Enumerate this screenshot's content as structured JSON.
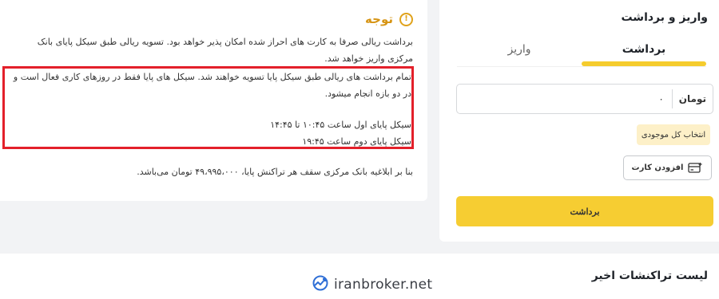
{
  "notice": {
    "title": "توجه",
    "para1": "برداشت ریالی صرفا به کارت های احراز شده امکان پذیر خواهد بود. تسویه ریالی طبق سیکل پایای بانک مرکزی واریز خواهد شد.",
    "para2": "تمام برداشت های ریالی طبق سیکل پایا تسویه خواهند شد. سیکل های پایا فقط در روزهای کاری فعال است و در دو بازه انجام میشود.",
    "cycle1": "سیکل پایای اول ساعت ۱۰:۴۵ تا ۱۴:۴۵",
    "cycle2": "سیکل پایای دوم ساعت ۱۹:۴۵",
    "para3": "بنا بر ابلاغیه بانک مرکزی سقف هر تراکنش پایا، ۴۹،۹۹۵،۰۰۰ تومان می‌باشد."
  },
  "card": {
    "title": "واریز و برداشت",
    "tabs": {
      "withdraw": "برداشت",
      "deposit": "واریز"
    },
    "amount": {
      "value": "۰",
      "unit": "تومان"
    },
    "select_all": "انتخاب کل موجودی",
    "add_card": "افزودن کارت",
    "submit": "برداشت"
  },
  "recent": {
    "title": "لیست تراکنشات اخیر"
  },
  "watermark": {
    "text": "iranbroker.net"
  },
  "colors": {
    "accent": "#f6cd32",
    "warning": "#d69413",
    "highlight_border": "#e3202a",
    "watermark_blue": "#2f6fd6"
  }
}
